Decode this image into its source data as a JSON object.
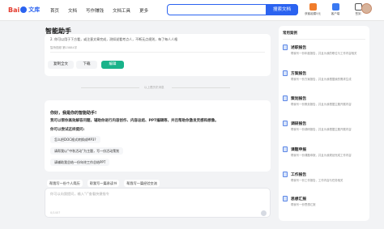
{
  "header": {
    "logo_text": "Bai",
    "logo_suffix": "文库",
    "nav": [
      "首页",
      "文档",
      "写作赚钱",
      "文档工具",
      "更多"
    ],
    "search_button": "搜索文档",
    "icons": [
      {
        "label": "获客组模5元",
        "color": "#f07c2b"
      },
      {
        "label": "客户端",
        "color": "#3a79f2"
      },
      {
        "label": "签到",
        "color": "#555555"
      }
    ]
  },
  "page_title": "智能助手",
  "prev_answer": {
    "line": "2. 你可以用于下方看，或注意文章完成，测如说看考点人，不断无点规则，每了每人人格",
    "source": "智桥视频  第15884字",
    "copy_label": "复制全文",
    "download_label": "下载",
    "edit_label": "编辑"
  },
  "divider_text": "以上是历史消息",
  "assistant": {
    "greeting": "你好，我是你的智能助手!",
    "intro": "我可以帮你高效解答问题，辅助你进行内容创作、内容总结、PPT编辑等，并且帮助你激发灵感和想像。",
    "try_label": "你可以尝试这样提问:",
    "suggestions": [
      "怎么把DOC格式转换成MP3?",
      "请帮我以“中秋活动”为主题，写一份活动策划",
      "请辅助我总结一份年终工作总结PPT"
    ]
  },
  "quick_chips": [
    "帮我写一份个人简历",
    "帮我写一篇承读书",
    "帮我写一篇经验交流"
  ],
  "input": {
    "placeholder": "你可以向我提问，输入“/”查看快捷指令",
    "counter": "0/1407"
  },
  "sidebar": {
    "title": "常用案例",
    "items": [
      {
        "title": "述职报告",
        "desc": "帮我写一份年度报告，并且为我的职位与工作内容相关"
      },
      {
        "title": "方案报告",
        "desc": "帮我写一份方案报告，并且为我根据我的需求生成"
      },
      {
        "title": "策划报告",
        "desc": "帮我写一份策划报告，并且为我根据主题开展内容"
      },
      {
        "title": "调研报告",
        "desc": "帮我写一份调研报告，并且为我根据主题开展内容"
      },
      {
        "title": "课题申报",
        "desc": "帮我写一份课题申报，并且为我规划完成工作内容"
      },
      {
        "title": "工作报告",
        "desc": "帮我写一份工作报告，工作内容与任务相关"
      },
      {
        "title": "思想汇报",
        "desc": "帮我写一份思想汇报"
      }
    ]
  }
}
